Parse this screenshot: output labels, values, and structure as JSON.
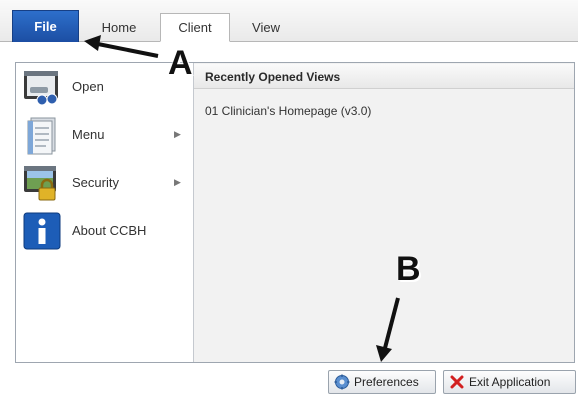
{
  "ribbon": {
    "tabs": [
      {
        "label": "File"
      },
      {
        "label": "Home"
      },
      {
        "label": "Client"
      },
      {
        "label": "View"
      }
    ]
  },
  "file_menu": {
    "items": [
      {
        "label": "Open",
        "icon": "open-icon"
      },
      {
        "label": "Menu",
        "icon": "menu-icon",
        "submenu": true
      },
      {
        "label": "Security",
        "icon": "security-icon",
        "submenu": true
      },
      {
        "label": "About CCBH",
        "icon": "info-icon"
      }
    ],
    "recent": {
      "title": "Recently Opened Views",
      "items": [
        "01 Clinician's Homepage (v3.0)"
      ]
    }
  },
  "footer": {
    "preferences_label": "Preferences",
    "exit_label": "Exit Application"
  },
  "annotations": {
    "a_label": "A",
    "b_label": "B"
  },
  "colors": {
    "file_tab": "#1c4ea3",
    "exit_icon": "#d22020"
  }
}
